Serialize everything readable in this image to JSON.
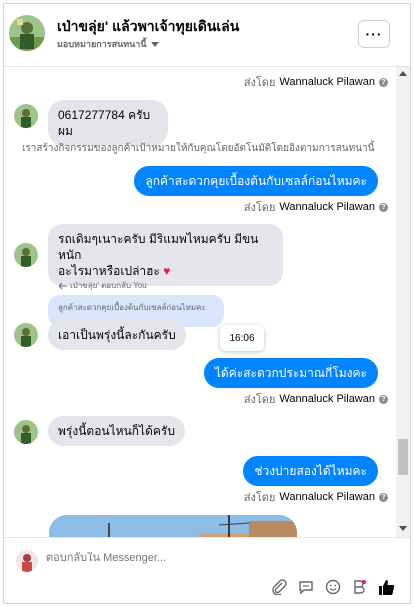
{
  "header": {
    "title": "เป่าขลุ่ย' แล้วพาเจ้าทุยเดินเล่น",
    "subtitle": "มอบหมายการสนทนานี้",
    "more_label": "···"
  },
  "messages": {
    "sent_by_prefix": "ส่งโดย",
    "agent_name": "Wannaluck Pilawan",
    "incoming_1": "0617277784 ครับผม",
    "system_notice": "เราสร้างกิจกรรมของลูกค้าเป้าหมายให้กับคุณโดยอัตโนมัติโดยอิงตามการสนทนานี้",
    "outgoing_1": "ลูกค้าสะดวกคุยเบื้องต้นกับเซลล์ก่อนไหมคะ",
    "incoming_2_line1": "รถเดิมๆเนาะครับ มีริแมพไหมครับ มีขนหนัก",
    "incoming_2_line2": "อะไรมาหรือเปล่าฮะ",
    "heart": "♥",
    "reply_label": "เป่าขลุ่ย' ตอบกลับ You",
    "quoted_text": "ลูกค้าสะดวกคุยเบื้องต้นกับเซลล์ก่อนไหมคะ",
    "incoming_3": "เอาเป็นพรุ่งนี้ละกันครับ",
    "timestamp": "16:06",
    "outgoing_2": "ได้ค่ะสะดวกประมาณกี่โมงคะ",
    "incoming_4": "พรุ่งนี้ตอนไหนก็ได้ครับ",
    "outgoing_3": "ช่วงบ่ายสองได้ไหมคะ"
  },
  "composer": {
    "placeholder": "ตอบกลับใน Messenger..."
  },
  "colors": {
    "accent": "#0084ff",
    "incoming_bubble": "#e4e6eb",
    "quoted_bubble": "#d8e6fb"
  },
  "icons": [
    "attach-icon",
    "sticker-icon",
    "emoji-icon",
    "bold-icon",
    "like-icon",
    "question-icon",
    "more-icon"
  ]
}
